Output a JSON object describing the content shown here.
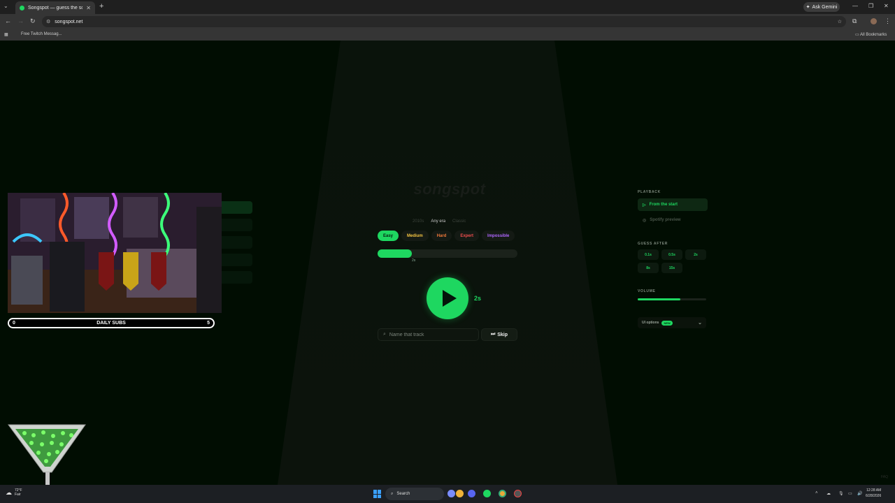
{
  "browser": {
    "tab_title": "Songspot — guess the song",
    "address": "songspot.net",
    "bookmark": "Free Twitch Messag...",
    "all_bookmarks": "All Bookmarks",
    "ask_gemini": "Ask Gemini"
  },
  "game": {
    "logo": "songspot",
    "eras": [
      {
        "label": "2010s",
        "active": false
      },
      {
        "label": "Any era",
        "active": true
      },
      {
        "label": "Classic",
        "active": false
      }
    ],
    "difficulties": [
      {
        "label": "Easy",
        "color": "#1ed760",
        "active": true
      },
      {
        "label": "Medium",
        "color": "#f5c542",
        "active": false
      },
      {
        "label": "Hard",
        "color": "#f07a3a",
        "active": false
      },
      {
        "label": "Expert",
        "color": "#f04e4e",
        "active": false
      },
      {
        "label": "Impossible",
        "color": "#b066ff",
        "active": false
      }
    ],
    "progress_fraction": 0.245,
    "progress_tick": "2s",
    "play_duration": "2s",
    "guess_placeholder": "Name that track",
    "skip_label": "Skip",
    "accent": "#1ed760"
  },
  "sidebar": {
    "playback_label": "PLAYBACK",
    "playback_options": [
      {
        "label": "From the start",
        "active": true
      },
      {
        "label": "Spotify preview",
        "active": false
      }
    ],
    "guess_after_label": "GUESS AFTER",
    "guess_after": [
      "0.1s",
      "0.5s",
      "2s",
      "8s",
      "15s"
    ],
    "volume_label": "VOLUME",
    "volume_fraction": 0.62,
    "ui_options": "UI options",
    "new_badge": "NEW"
  },
  "overlay": {
    "subs_label": "DAILY SUBS",
    "subs_left": "0",
    "subs_right": "5"
  },
  "footer_watermark": "FAQ",
  "taskbar": {
    "weather_temp": "72°F",
    "weather_desc": "Fair",
    "search": "Search",
    "time": "12:28 AM",
    "date": "6/28/2026"
  }
}
